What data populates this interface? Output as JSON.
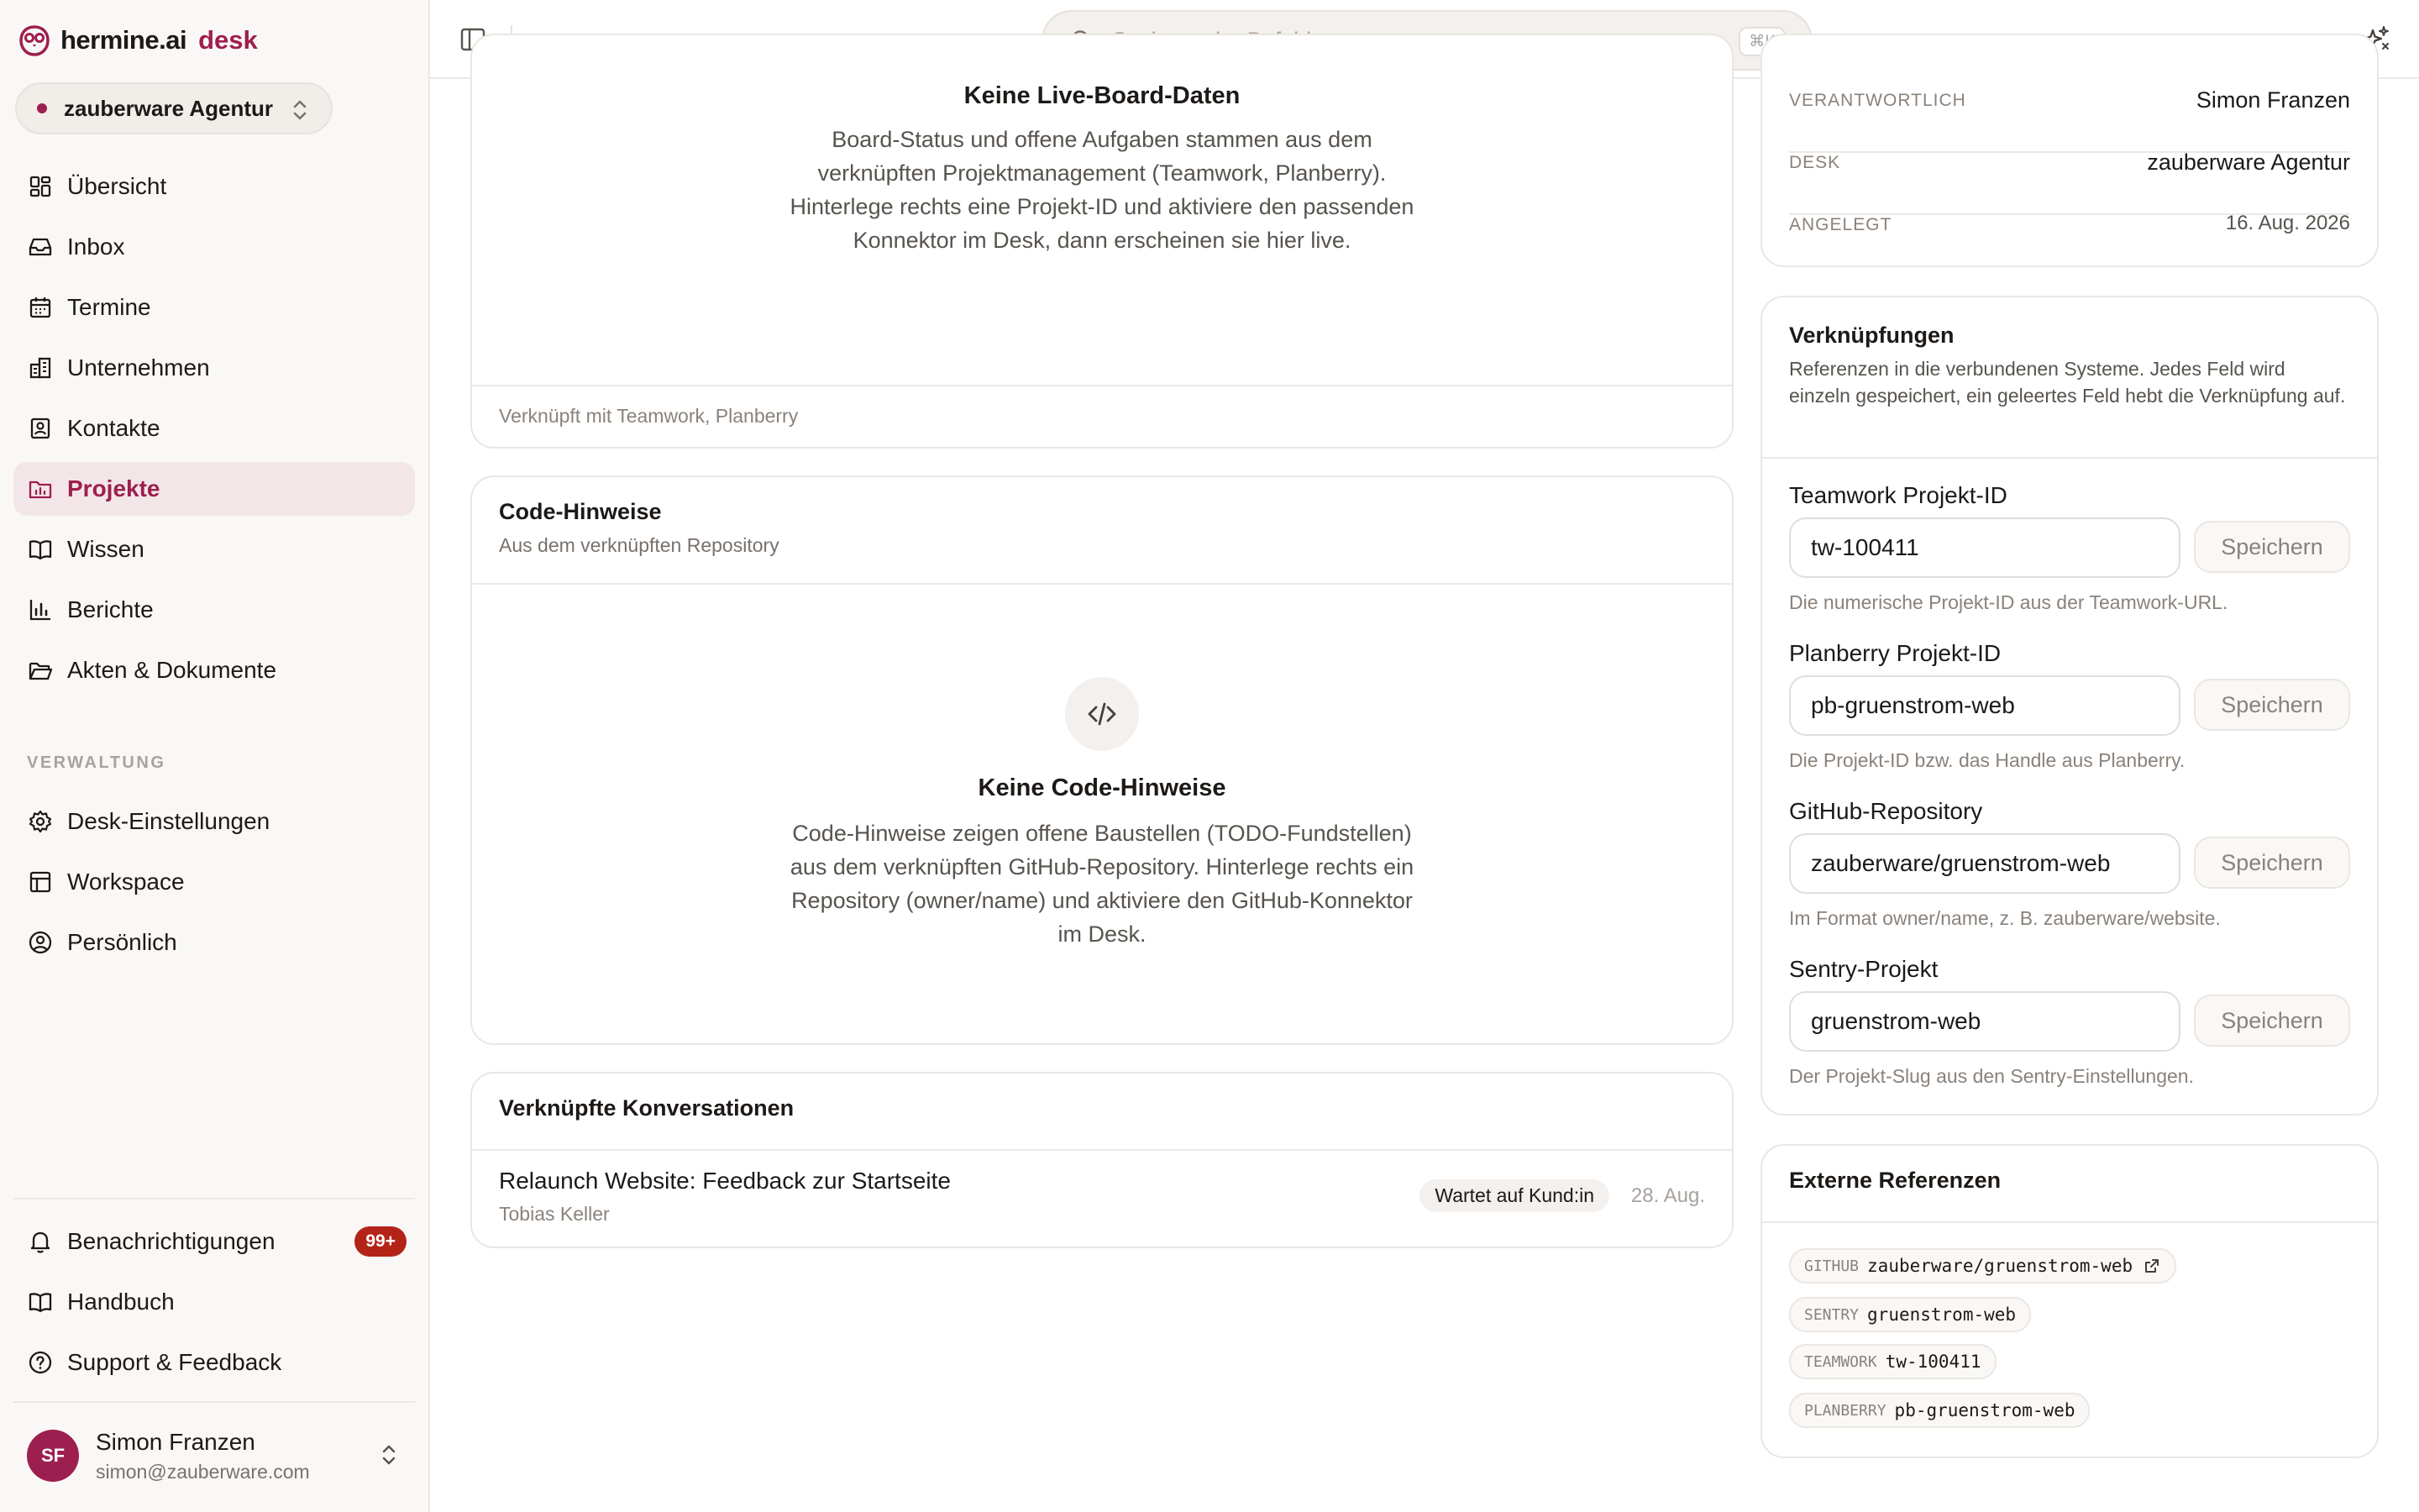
{
  "brand": {
    "name": "hermine.ai",
    "product": "desk"
  },
  "workspace": {
    "name": "zauberware Agentur"
  },
  "nav": {
    "items": [
      {
        "label": "Übersicht"
      },
      {
        "label": "Inbox"
      },
      {
        "label": "Termine"
      },
      {
        "label": "Unternehmen"
      },
      {
        "label": "Kontakte"
      },
      {
        "label": "Projekte"
      },
      {
        "label": "Wissen"
      },
      {
        "label": "Berichte"
      },
      {
        "label": "Akten & Dokumente"
      }
    ],
    "section_label": "VERWALTUNG",
    "admin_items": [
      {
        "label": "Desk-Einstellungen"
      },
      {
        "label": "Workspace"
      },
      {
        "label": "Persönlich"
      }
    ],
    "bottom_items": [
      {
        "label": "Benachrichtigungen",
        "badge": "99+"
      },
      {
        "label": "Handbuch"
      },
      {
        "label": "Support & Feedback"
      }
    ]
  },
  "user": {
    "initials": "SF",
    "name": "Simon Franzen",
    "email": "simon@zauberware.com"
  },
  "search": {
    "placeholder": "Suchen oder Befehl ...",
    "shortcut": "⌘K"
  },
  "board": {
    "empty_title": "Keine Live-Board-Daten",
    "empty_text": "Board-Status und offene Aufgaben stammen aus dem verknüpften Projektmanagement (Teamwork, Planberry). Hinterlege rechts eine Projekt-ID und aktiviere den passenden Konnektor im Desk, dann erscheinen sie hier live.",
    "footnote": "Verknüpft mit Teamwork, Planberry"
  },
  "code": {
    "title": "Code-Hinweise",
    "subtitle": "Aus dem verknüpften Repository",
    "empty_title": "Keine Code-Hinweise",
    "empty_text": "Code-Hinweise zeigen offene Baustellen (TODO-Fundstellen) aus dem verknüpften GitHub-Repository. Hinterlege rechts ein Repository (owner/name) und aktiviere den GitHub-Konnektor im Desk."
  },
  "conversations": {
    "title": "Verknüpfte Konversationen",
    "items": [
      {
        "title": "Relaunch Website: Feedback zur Startseite",
        "person": "Tobias Keller",
        "status": "Wartet auf Kund:in",
        "date": "28. Aug."
      }
    ]
  },
  "meta": {
    "rows": [
      {
        "key": "VERANTWORTLICH",
        "value": "Simon Franzen"
      },
      {
        "key": "DESK",
        "value": "zauberware Agentur"
      },
      {
        "key": "ANGELEGT",
        "value": "16. Aug. 2026"
      }
    ]
  },
  "links": {
    "title": "Verknüpfungen",
    "description": "Referenzen in die verbundenen Systeme. Jedes Feld wird einzeln gespeichert, ein geleertes Feld hebt die Verknüpfung auf.",
    "save_label": "Speichern",
    "fields": [
      {
        "label": "Teamwork Projekt-ID",
        "value": "tw-100411",
        "hint": "Die numerische Projekt-ID aus der Teamwork-URL."
      },
      {
        "label": "Planberry Projekt-ID",
        "value": "pb-gruenstrom-web",
        "hint": "Die Projekt-ID bzw. das Handle aus Planberry."
      },
      {
        "label": "GitHub-Repository",
        "value": "zauberware/gruenstrom-web",
        "hint": "Im Format owner/name, z. B. zauberware/website."
      },
      {
        "label": "Sentry-Projekt",
        "value": "gruenstrom-web",
        "hint": "Der Projekt-Slug aus den Sentry-Einstellungen."
      }
    ]
  },
  "external": {
    "title": "Externe Referenzen",
    "refs": [
      {
        "key": "GITHUB",
        "value": "zauberware/gruenstrom-web",
        "icon": "external-link-icon"
      },
      {
        "key": "SENTRY",
        "value": "gruenstrom-web"
      },
      {
        "key": "TEAMWORK",
        "value": "tw-100411"
      },
      {
        "key": "PLANBERRY",
        "value": "pb-gruenstrom-web"
      }
    ]
  },
  "colors": {
    "accent": "#9d1f4f",
    "badge": "#b42318",
    "active_bg": "#f3e6e8"
  }
}
